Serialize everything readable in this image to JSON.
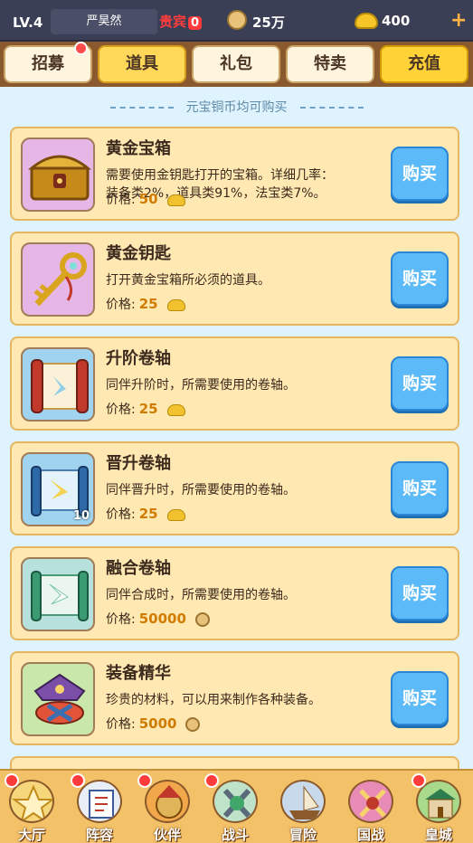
{
  "player": {
    "level": "LV.4",
    "name": "严昊然",
    "vip_label": "贵宾",
    "vip_level": "0",
    "coins": "25万",
    "ingots": "400"
  },
  "tabs": [
    {
      "label": "招募"
    },
    {
      "label": "道具"
    },
    {
      "label": "礼包"
    },
    {
      "label": "特卖"
    },
    {
      "label": "充值"
    }
  ],
  "note": "元宝铜币均可购买",
  "items": [
    {
      "name": "黄金宝箱",
      "desc_line1": "需要使用金钥匙打开的宝箱。详细几率：",
      "desc_line2": "装备类2%，道具类91%，法宝类7%。",
      "price_label": "价格:",
      "price": "50",
      "currency": "ingot",
      "buy_label": "购买",
      "icon": "golden-chest-icon"
    },
    {
      "name": "黄金钥匙",
      "desc_line1": "打开黄金宝箱所必须的道具。",
      "desc_line2": "",
      "price_label": "价格:",
      "price": "25",
      "currency": "ingot",
      "buy_label": "购买",
      "icon": "golden-key-icon"
    },
    {
      "name": "升阶卷轴",
      "desc_line1": "同伴升阶时，所需要使用的卷轴。",
      "desc_line2": "",
      "price_label": "价格:",
      "price": "25",
      "currency": "ingot",
      "buy_label": "购买",
      "icon": "scroll-icon"
    },
    {
      "name": "晋升卷轴",
      "desc_line1": "同伴晋升时，所需要使用的卷轴。",
      "desc_line2": "",
      "price_label": "价格:",
      "price": "25",
      "currency": "ingot",
      "buy_label": "购买",
      "icon": "scroll-icon",
      "count": "10"
    },
    {
      "name": "融合卷轴",
      "desc_line1": "同伴合成时，所需要使用的卷轴。",
      "desc_line2": "",
      "price_label": "价格:",
      "price": "50000",
      "currency": "copper",
      "buy_label": "购买",
      "icon": "scroll-icon"
    },
    {
      "name": "装备精华",
      "desc_line1": "珍贵的材料，可以用来制作各种装备。",
      "desc_line2": "",
      "price_label": "价格:",
      "price": "5000",
      "currency": "copper",
      "buy_label": "购买",
      "icon": "equipment-essence-icon"
    }
  ],
  "nav": [
    {
      "label": "大厅",
      "icon": "hall-icon"
    },
    {
      "label": "阵容",
      "icon": "lineup-icon"
    },
    {
      "label": "伙伴",
      "icon": "partner-icon"
    },
    {
      "label": "战斗",
      "icon": "battle-icon"
    },
    {
      "label": "冒险",
      "icon": "adventure-icon"
    },
    {
      "label": "国战",
      "icon": "nation-war-icon"
    },
    {
      "label": "皇城",
      "icon": "royal-city-icon"
    }
  ]
}
